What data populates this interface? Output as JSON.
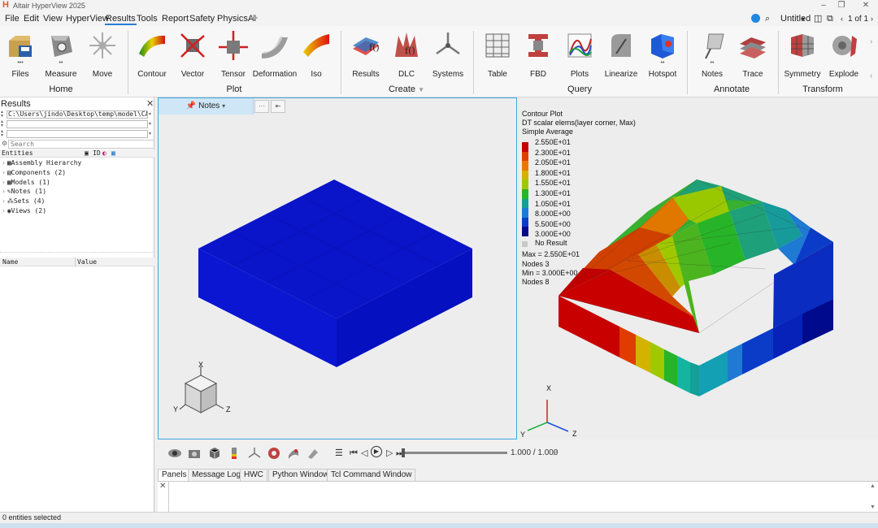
{
  "app": {
    "title": "Altair HyperView 2025"
  },
  "menubar": {
    "items": [
      "File",
      "Edit",
      "View",
      "HyperView",
      "Results",
      "Tools",
      "Report",
      "Safety",
      "PhysicsAI"
    ],
    "active": "Results",
    "doc_title": "Untitled",
    "page_indicator": "1 of 1"
  },
  "ribbon": {
    "tools": [
      {
        "key": "files",
        "label": "Files"
      },
      {
        "key": "measure",
        "label": "Measure"
      },
      {
        "key": "move",
        "label": "Move"
      },
      {
        "key": "contour",
        "label": "Contour"
      },
      {
        "key": "vector",
        "label": "Vector"
      },
      {
        "key": "tensor",
        "label": "Tensor"
      },
      {
        "key": "deformation",
        "label": "Deformation"
      },
      {
        "key": "iso",
        "label": "Iso"
      },
      {
        "key": "results",
        "label": "Results"
      },
      {
        "key": "dlc",
        "label": "DLC"
      },
      {
        "key": "systems",
        "label": "Systems"
      },
      {
        "key": "table",
        "label": "Table"
      },
      {
        "key": "fbd",
        "label": "FBD"
      },
      {
        "key": "plots",
        "label": "Plots"
      },
      {
        "key": "linearize",
        "label": "Linearize"
      },
      {
        "key": "hotspot",
        "label": "Hotspot"
      },
      {
        "key": "notes",
        "label": "Notes"
      },
      {
        "key": "trace",
        "label": "Trace"
      },
      {
        "key": "symmetry",
        "label": "Symmetry"
      },
      {
        "key": "explode",
        "label": "Explode"
      }
    ],
    "groups": [
      "Home",
      "Plot",
      "Create",
      "Query",
      "Annotate",
      "Transform"
    ]
  },
  "results_panel": {
    "title": "Results",
    "path": "C:\\Users\\jindo\\Desktop\\temp\\model\\CAE",
    "search_placeholder": "Search",
    "entities_header": "Entities",
    "id_header": "ID",
    "tree": [
      "Assembly Hierarchy",
      "Components (2)",
      "Models (1)",
      "Notes (1)",
      "Sets (4)",
      "Views (2)"
    ],
    "name_header": "Name",
    "value_header": "Value"
  },
  "viewport1": {
    "notes_label": "Notes",
    "more_label": "···",
    "model_color": "#0a14c8"
  },
  "viewport2": {
    "legend": {
      "title": "Contour Plot",
      "subtitle": "DT scalar elems(layer corner, Max)",
      "averaging": "Simple Average",
      "labels": [
        "2.550E+01",
        "2.300E+01",
        "2.050E+01",
        "1.800E+01",
        "1.550E+01",
        "1.300E+01",
        "1.050E+01",
        "8.000E+00",
        "5.500E+00",
        "3.000E+00"
      ],
      "colors": [
        "#c80000",
        "#e03c00",
        "#e87800",
        "#d2b400",
        "#a0c800",
        "#28b428",
        "#14a096",
        "#1e7ad2",
        "#0a3cc8",
        "#000a8c"
      ],
      "no_result": "No Result",
      "max_label": "Max = 2.550E+01",
      "max_nodes": "Nodes 3",
      "min_label": "Min = 3.000E+00",
      "min_nodes": "Nodes 8"
    }
  },
  "triad": {
    "x": "X",
    "y": "Y",
    "z": "Z"
  },
  "animation": {
    "frame": "1.000 / 1.000"
  },
  "bottom_tabs": [
    "Panels",
    "Message Log",
    "HWC",
    "Python Window",
    "Tcl Command Window"
  ],
  "status": {
    "text": "0 entities selected"
  }
}
